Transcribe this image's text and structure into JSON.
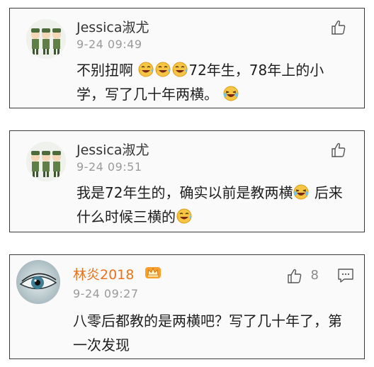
{
  "comments": [
    {
      "user": "Jessica淑尤",
      "time": "9-24 09:49",
      "text_segments": [
        "不别扭啊",
        "72年生，78年上的小学，写了几十年两横。"
      ],
      "icons": [
        "laugh-cry-emoji",
        "laugh-cry-emoji",
        "laugh-cry-emoji",
        "tears-of-joy-emoji",
        "thumbs-up-icon"
      ]
    },
    {
      "user": "Jessica淑尤",
      "time": "9-24 09:51",
      "text_segments": [
        "我是72年生的，确实以前是教两横",
        "后来什么时候三横的"
      ],
      "icons": [
        "tears-of-joy-emoji",
        "laugh-cry-emoji",
        "thumbs-up-icon"
      ]
    },
    {
      "user": "林炎2018",
      "time": "9-24 09:27",
      "like_count": "8",
      "text_segments": [
        "八零后都教的是两横吧？写了几十年了，第一次发现"
      ],
      "icons": [
        "vip-crown-icon",
        "thumbs-up-icon",
        "comment-icon"
      ],
      "name_color": "#e8731c"
    }
  ],
  "colors": {
    "card_bg": "#fafafa",
    "border": "#3a3a3a",
    "time": "#9a9a9a",
    "emoji_face": "#f6c544"
  }
}
